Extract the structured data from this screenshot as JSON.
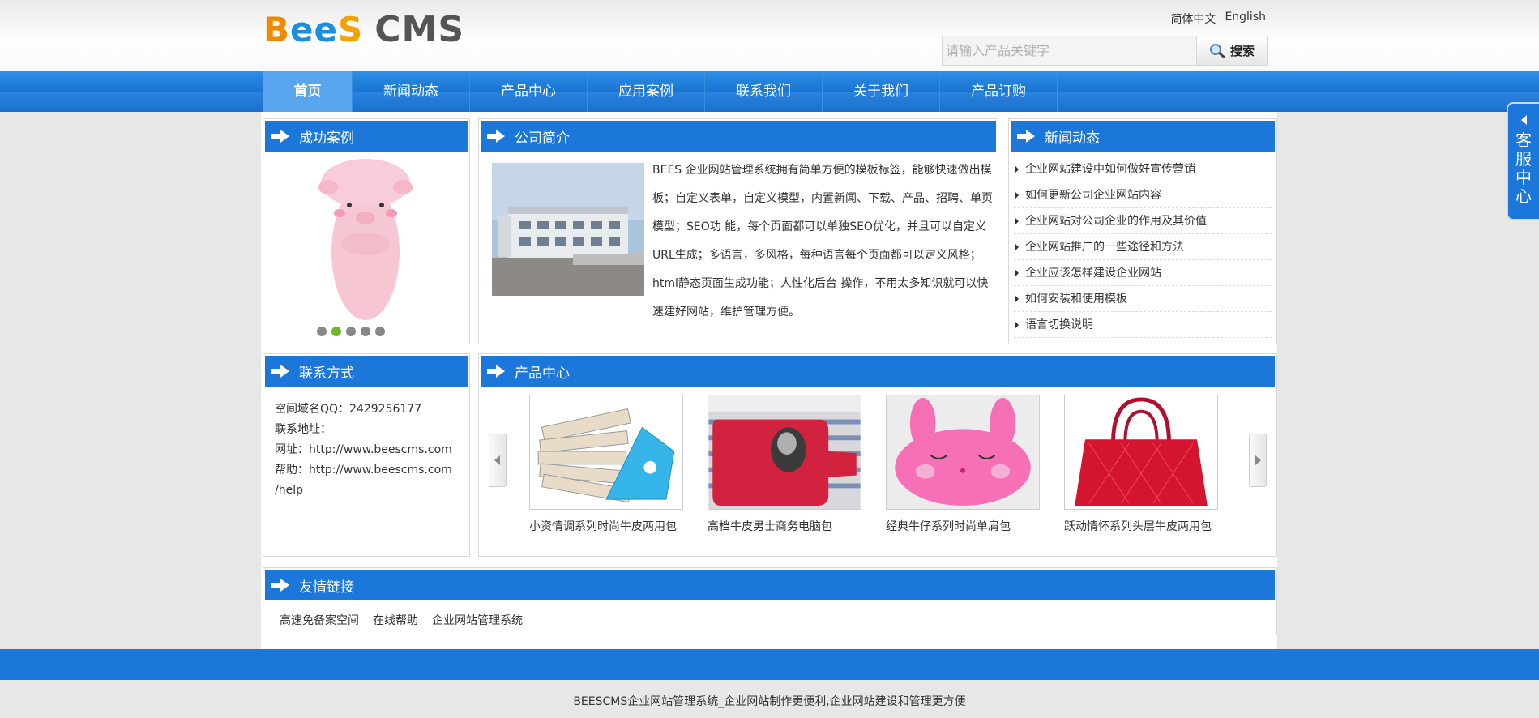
{
  "header": {
    "logo_text": "BEES CMS",
    "languages": [
      "简体中文",
      "English"
    ],
    "search": {
      "placeholder": "请输入产品关键字",
      "button_label": "搜索"
    }
  },
  "nav": {
    "items": [
      "首页",
      "新闻动态",
      "产品中心",
      "应用案例",
      "联系我们",
      "关于我们",
      "产品订购"
    ],
    "active_index": 0
  },
  "cases": {
    "title": "成功案例",
    "slide_count": 5,
    "active_slide": 2
  },
  "about": {
    "title": "公司简介",
    "text": "BEES 企业网站管理系统拥有简单方便的模板标签，能够快速做出模板；自定义表单，自定义模型，内置新闻、下载、产品、招聘、单页模型；SEO功 能，每个页面都可以单独SEO优化，并且可以自定义URL生成；多语言，多风格，每种语言每个页面都可以定义风格；html静态页面生成功能；人性化后台 操作，不用太多知识就可以快速建好网站，维护管理方便。"
  },
  "news": {
    "title": "新闻动态",
    "items": [
      "企业网站建设中如何做好宣传营销",
      "如何更新公司企业网站内容",
      "企业网站对公司企业的作用及其价值",
      "企业网站推广的一些途径和方法",
      "企业应该怎样建设企业网站",
      "如何安装和使用模板",
      "语言切换说明"
    ]
  },
  "contact": {
    "title": "联系方式",
    "lines": [
      "空间域名QQ：2429256177",
      "联系地址：",
      "网址：http://www.beescms.com",
      "帮助：http://www.beescms.com",
      "/help"
    ]
  },
  "products": {
    "title": "产品中心",
    "items": [
      "小资情调系列时尚牛皮两用包",
      "高档牛皮男士商务电脑包",
      "经典牛仔系列时尚单肩包",
      "跃动情怀系列头层牛皮两用包"
    ]
  },
  "links": {
    "title": "友情链接",
    "items": [
      "高速免备案空间",
      "在线帮助",
      "企业网站管理系统"
    ]
  },
  "footer": {
    "text": "BEESCMS企业网站管理系统_企业网站制作更便利,企业网站建设和管理更方便"
  },
  "kefu": {
    "label": "客服中心"
  },
  "colors": {
    "brand_blue": "#1b77d9",
    "active_dot": "#6fb82b"
  }
}
